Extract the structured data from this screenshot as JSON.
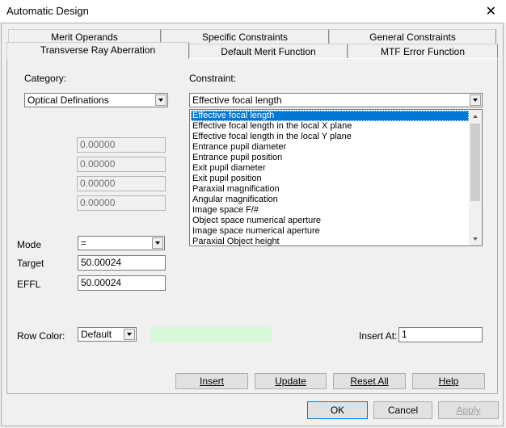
{
  "window": {
    "title": "Automatic Design",
    "close_glyph": "✕"
  },
  "tabs_row1": [
    "Merit Operands",
    "Specific Constraints",
    "General Constraints"
  ],
  "tabs_row2": [
    "Transverse Ray Aberration",
    "Default Merit Function",
    "MTF Error Function"
  ],
  "category": {
    "label": "Category:",
    "value": "Optical Definations"
  },
  "constraint": {
    "label": "Constraint:",
    "value": "Effective focal length",
    "options": [
      "Effective focal length",
      "Effective focal length in the local X plane",
      "Effective focal length in the local Y plane",
      "Entrance pupil diameter",
      "Entrance pupil position",
      "Exit pupil diameter",
      "Exit pupil position",
      "Paraxial magnification",
      "Angular magnification",
      "Image space F/#",
      "Object space numerical aperture",
      "Image space numerical aperture",
      "Paraxial Object height"
    ]
  },
  "params": [
    "0.00000",
    "0.00000",
    "0.00000",
    "0.00000"
  ],
  "mode": {
    "label": "Mode",
    "value": "="
  },
  "target": {
    "label": "Target",
    "value": "50.00024"
  },
  "effl": {
    "label": "EFFL",
    "value": "50.00024"
  },
  "row_color": {
    "label": "Row Color:",
    "value": "Default",
    "swatch_color": "#d9f7d9"
  },
  "insert_at": {
    "label": "Insert At:",
    "value": "1"
  },
  "buttons": {
    "insert": "Insert",
    "update": "Update",
    "reset_all": "Reset All",
    "help": "Help",
    "ok": "OK",
    "cancel": "Cancel",
    "apply": "Apply"
  },
  "colors": {
    "selection": "#0078d7",
    "dialog_bg": "#f0f0f0"
  }
}
